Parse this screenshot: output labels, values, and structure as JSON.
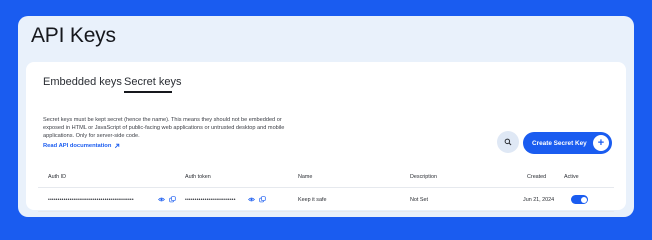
{
  "page": {
    "title": "API Keys"
  },
  "tabs": [
    {
      "label": "Embedded keys",
      "active": false
    },
    {
      "label": "Secret keys",
      "active": true
    }
  ],
  "description": "Secret keys must be kept secret (hence the name). This means they should not be embedded or exposed in HTML or JavaScript of public-facing web applications or untrusted desktop and mobile applications. Only for server-side code.",
  "doc_link": {
    "label": "Read API documentation",
    "icon": "arrow-up-right-icon"
  },
  "actions": {
    "search_icon": "search-icon",
    "create_label": "Create Secret Key",
    "create_icon": "plus-icon"
  },
  "table": {
    "columns": [
      "Auth ID",
      "Auth token",
      "Name",
      "Description",
      "Created",
      "Active"
    ],
    "rows": [
      {
        "auth_id": "••••••••••••••••••••••••••••••••••••••••••••",
        "auth_token": "••••••••••••••••••••••••••",
        "name": "Keep it safe",
        "description": "Not Set",
        "created": "Jun 21, 2024",
        "active": true
      }
    ]
  },
  "colors": {
    "accent": "#1a5cf0",
    "background": "#1a5cf0",
    "panel": "#e9f1fb"
  }
}
